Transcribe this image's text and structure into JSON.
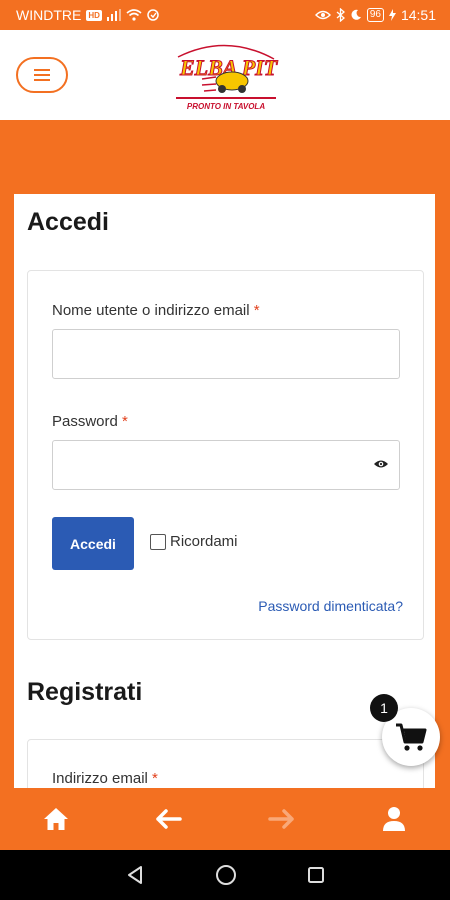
{
  "status_bar": {
    "carrier": "WINDTRE",
    "network_badge": "HD",
    "battery": "96",
    "time": "14:51"
  },
  "header": {
    "logo_text": "ELBA PIT",
    "logo_subtext": "PRONTO IN TAVOLA",
    "menu_icon": "hamburger-icon"
  },
  "login": {
    "title": "Accedi",
    "username_label": "Nome utente o indirizzo email",
    "required_mark": "*",
    "username_value": "",
    "password_label": "Password",
    "password_value": "",
    "submit_label": "Accedi",
    "remember_label": "Ricordami",
    "remember_checked": false,
    "forgot_link": "Password dimenticata?"
  },
  "register": {
    "title": "Registrati",
    "email_label": "Indirizzo email"
  },
  "cart": {
    "count": "1",
    "icon": "cart-icon"
  },
  "bottom_nav": {
    "items": [
      {
        "icon": "home-icon"
      },
      {
        "icon": "arrow-left-icon"
      },
      {
        "icon": "arrow-right-icon"
      },
      {
        "icon": "user-icon"
      }
    ]
  },
  "colors": {
    "brand_orange": "#f37021",
    "button_blue": "#2b5bb4",
    "required_red": "#e2401c"
  }
}
